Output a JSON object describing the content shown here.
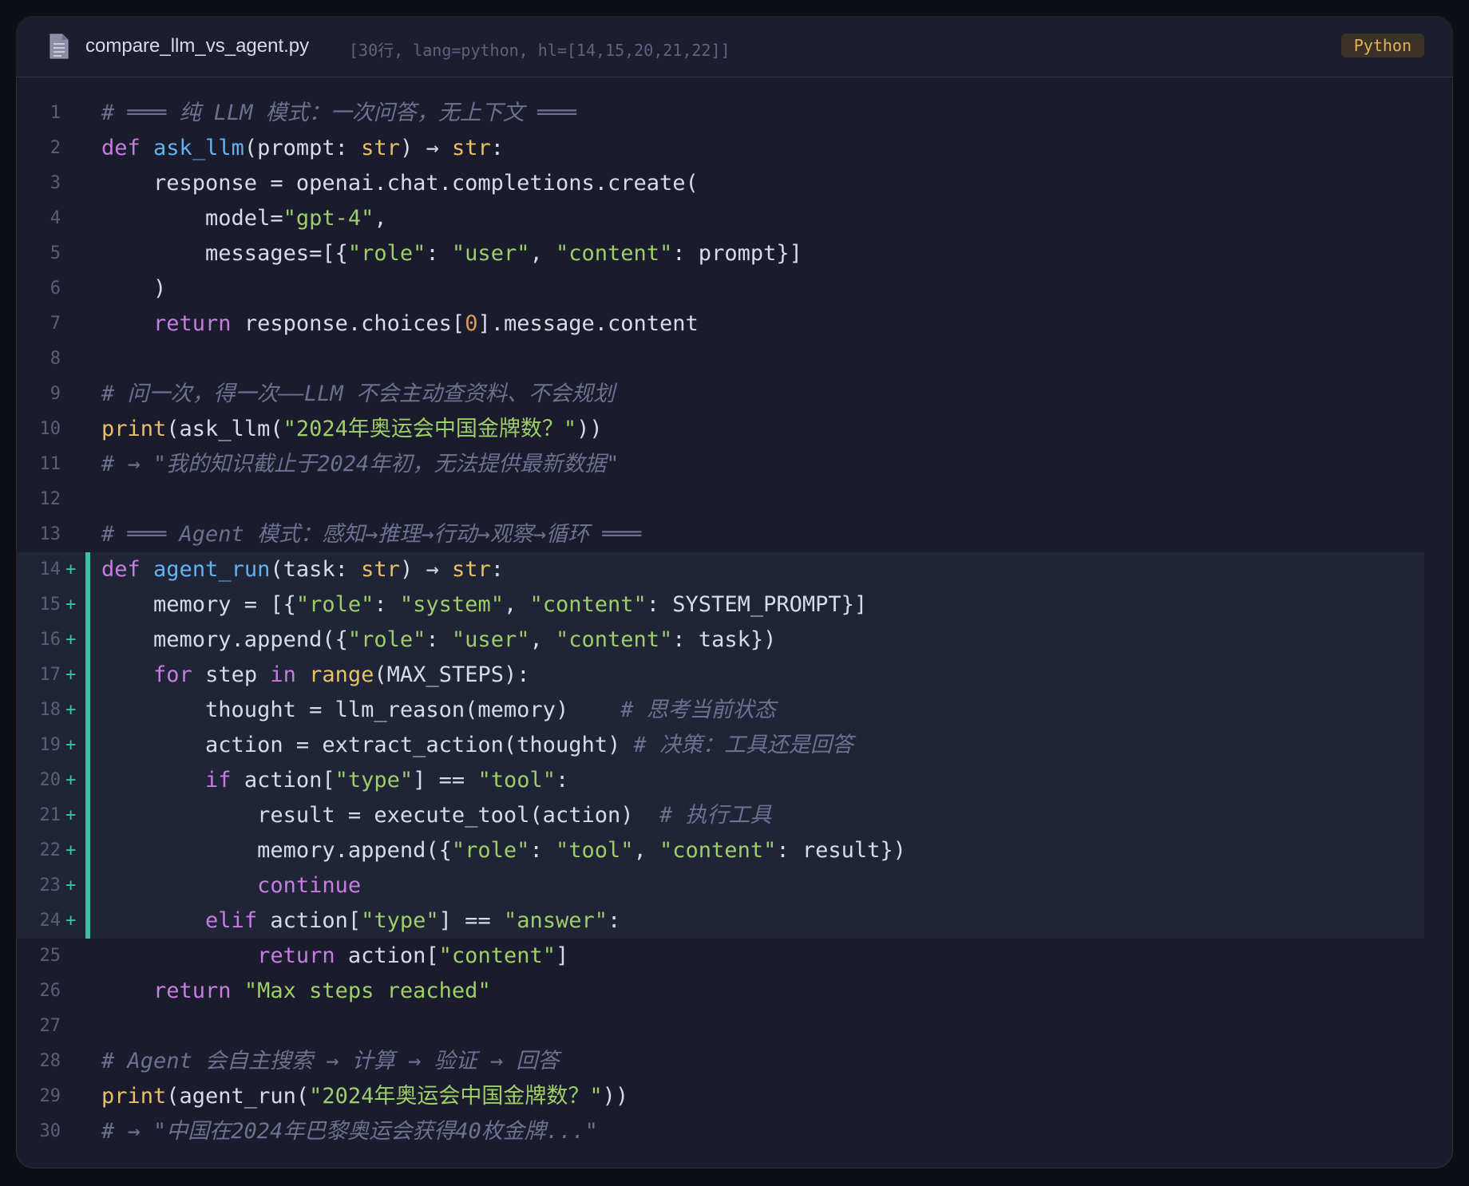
{
  "window": {
    "filename": "compare_llm_vs_agent.py",
    "meta": "[30行, lang=python, hl=[14,15,20,21,22]]",
    "language_badge": "Python",
    "file_icon": "document-icon"
  },
  "colors": {
    "background": "#1a1b2c",
    "keyword": "#c67de0",
    "function": "#63b3f0",
    "builtin": "#e8c06a",
    "string": "#9ece6a",
    "number": "#e09956",
    "comment": "#6d7190",
    "text": "#d8dae6",
    "highlight_bar": "#3fbfa5"
  },
  "code": {
    "lines": [
      {
        "n": "1",
        "marker": "",
        "hl": false,
        "tokens": [
          [
            "com",
            "# ═══ 纯 LLM 模式：一次问答，无上下文 ═══"
          ]
        ]
      },
      {
        "n": "2",
        "marker": "",
        "hl": false,
        "tokens": [
          [
            "kw",
            "def"
          ],
          [
            "txt",
            " "
          ],
          [
            "fn",
            "ask_llm"
          ],
          [
            "txt",
            "(prompt: "
          ],
          [
            "bi",
            "str"
          ],
          [
            "txt",
            ") → "
          ],
          [
            "bi",
            "str"
          ],
          [
            "txt",
            ":"
          ]
        ]
      },
      {
        "n": "3",
        "marker": "",
        "hl": false,
        "tokens": [
          [
            "txt",
            "    response = openai.chat.completions.create("
          ]
        ]
      },
      {
        "n": "4",
        "marker": "",
        "hl": false,
        "tokens": [
          [
            "txt",
            "        model="
          ],
          [
            "str",
            "\"gpt-4\""
          ],
          [
            "txt",
            ","
          ]
        ]
      },
      {
        "n": "5",
        "marker": "",
        "hl": false,
        "tokens": [
          [
            "txt",
            "        messages=[{"
          ],
          [
            "str",
            "\"role\""
          ],
          [
            "txt",
            ": "
          ],
          [
            "str",
            "\"user\""
          ],
          [
            "txt",
            ", "
          ],
          [
            "str",
            "\"content\""
          ],
          [
            "txt",
            ": prompt}]"
          ]
        ]
      },
      {
        "n": "6",
        "marker": "",
        "hl": false,
        "tokens": [
          [
            "txt",
            "    )"
          ]
        ]
      },
      {
        "n": "7",
        "marker": "",
        "hl": false,
        "tokens": [
          [
            "txt",
            "    "
          ],
          [
            "kw",
            "return"
          ],
          [
            "txt",
            " response.choices["
          ],
          [
            "num",
            "0"
          ],
          [
            "txt",
            "].message.content"
          ]
        ]
      },
      {
        "n": "8",
        "marker": "",
        "hl": false,
        "tokens": []
      },
      {
        "n": "9",
        "marker": "",
        "hl": false,
        "tokens": [
          [
            "com",
            "# 问一次，得一次——LLM 不会主动查资料、不会规划"
          ]
        ]
      },
      {
        "n": "10",
        "marker": "",
        "hl": false,
        "tokens": [
          [
            "bi",
            "print"
          ],
          [
            "txt",
            "(ask_llm("
          ],
          [
            "str",
            "\"2024年奥运会中国金牌数？\""
          ],
          [
            "txt",
            "))"
          ]
        ]
      },
      {
        "n": "11",
        "marker": "",
        "hl": false,
        "tokens": [
          [
            "com",
            "# → \"我的知识截止于2024年初，无法提供最新数据\""
          ]
        ]
      },
      {
        "n": "12",
        "marker": "",
        "hl": false,
        "tokens": []
      },
      {
        "n": "13",
        "marker": "",
        "hl": false,
        "tokens": [
          [
            "com",
            "# ═══ Agent 模式：感知→推理→行动→观察→循环 ═══"
          ]
        ]
      },
      {
        "n": "14",
        "marker": "+",
        "hl": true,
        "tokens": [
          [
            "kw",
            "def"
          ],
          [
            "txt",
            " "
          ],
          [
            "fn",
            "agent_run"
          ],
          [
            "txt",
            "(task: "
          ],
          [
            "bi",
            "str"
          ],
          [
            "txt",
            ") → "
          ],
          [
            "bi",
            "str"
          ],
          [
            "txt",
            ":"
          ]
        ]
      },
      {
        "n": "15",
        "marker": "+",
        "hl": true,
        "tokens": [
          [
            "txt",
            "    memory = [{"
          ],
          [
            "str",
            "\"role\""
          ],
          [
            "txt",
            ": "
          ],
          [
            "str",
            "\"system\""
          ],
          [
            "txt",
            ", "
          ],
          [
            "str",
            "\"content\""
          ],
          [
            "txt",
            ": SYSTEM_PROMPT}]"
          ]
        ]
      },
      {
        "n": "16",
        "marker": "+",
        "hl": true,
        "tokens": [
          [
            "txt",
            "    memory.append({"
          ],
          [
            "str",
            "\"role\""
          ],
          [
            "txt",
            ": "
          ],
          [
            "str",
            "\"user\""
          ],
          [
            "txt",
            ", "
          ],
          [
            "str",
            "\"content\""
          ],
          [
            "txt",
            ": task})"
          ]
        ]
      },
      {
        "n": "17",
        "marker": "+",
        "hl": true,
        "tokens": [
          [
            "txt",
            "    "
          ],
          [
            "kw",
            "for"
          ],
          [
            "txt",
            " step "
          ],
          [
            "kw",
            "in"
          ],
          [
            "txt",
            " "
          ],
          [
            "bi",
            "range"
          ],
          [
            "txt",
            "(MAX_STEPS):"
          ]
        ]
      },
      {
        "n": "18",
        "marker": "+",
        "hl": true,
        "tokens": [
          [
            "txt",
            "        thought = llm_reason(memory)    "
          ],
          [
            "com",
            "# 思考当前状态"
          ]
        ]
      },
      {
        "n": "19",
        "marker": "+",
        "hl": true,
        "tokens": [
          [
            "txt",
            "        action = extract_action(thought) "
          ],
          [
            "com",
            "# 决策：工具还是回答"
          ]
        ]
      },
      {
        "n": "20",
        "marker": "+",
        "hl": true,
        "tokens": [
          [
            "txt",
            "        "
          ],
          [
            "kw",
            "if"
          ],
          [
            "txt",
            " action["
          ],
          [
            "str",
            "\"type\""
          ],
          [
            "txt",
            "] == "
          ],
          [
            "str",
            "\"tool\""
          ],
          [
            "txt",
            ":"
          ]
        ]
      },
      {
        "n": "21",
        "marker": "+",
        "hl": true,
        "tokens": [
          [
            "txt",
            "            result = execute_tool(action)  "
          ],
          [
            "com",
            "# 执行工具"
          ]
        ]
      },
      {
        "n": "22",
        "marker": "+",
        "hl": true,
        "tokens": [
          [
            "txt",
            "            memory.append({"
          ],
          [
            "str",
            "\"role\""
          ],
          [
            "txt",
            ": "
          ],
          [
            "str",
            "\"tool\""
          ],
          [
            "txt",
            ", "
          ],
          [
            "str",
            "\"content\""
          ],
          [
            "txt",
            ": result})"
          ]
        ]
      },
      {
        "n": "23",
        "marker": "+",
        "hl": true,
        "tokens": [
          [
            "txt",
            "            "
          ],
          [
            "kw",
            "continue"
          ]
        ]
      },
      {
        "n": "24",
        "marker": "+",
        "hl": true,
        "tokens": [
          [
            "txt",
            "        "
          ],
          [
            "kw",
            "elif"
          ],
          [
            "txt",
            " action["
          ],
          [
            "str",
            "\"type\""
          ],
          [
            "txt",
            "] == "
          ],
          [
            "str",
            "\"answer\""
          ],
          [
            "txt",
            ":"
          ]
        ]
      },
      {
        "n": "25",
        "marker": "",
        "hl": false,
        "tokens": [
          [
            "txt",
            "            "
          ],
          [
            "kw",
            "return"
          ],
          [
            "txt",
            " action["
          ],
          [
            "str",
            "\"content\""
          ],
          [
            "txt",
            "]"
          ]
        ]
      },
      {
        "n": "26",
        "marker": "",
        "hl": false,
        "tokens": [
          [
            "txt",
            "    "
          ],
          [
            "kw",
            "return"
          ],
          [
            "txt",
            " "
          ],
          [
            "str",
            "\"Max steps reached\""
          ]
        ]
      },
      {
        "n": "27",
        "marker": "",
        "hl": false,
        "tokens": []
      },
      {
        "n": "28",
        "marker": "",
        "hl": false,
        "tokens": [
          [
            "com",
            "# Agent 会自主搜索 → 计算 → 验证 → 回答"
          ]
        ]
      },
      {
        "n": "29",
        "marker": "",
        "hl": false,
        "tokens": [
          [
            "bi",
            "print"
          ],
          [
            "txt",
            "(agent_run("
          ],
          [
            "str",
            "\"2024年奥运会中国金牌数？\""
          ],
          [
            "txt",
            "))"
          ]
        ]
      },
      {
        "n": "30",
        "marker": "",
        "hl": false,
        "tokens": [
          [
            "com",
            "# → \"中国在2024年巴黎奥运会获得40枚金牌...\""
          ]
        ]
      }
    ]
  }
}
